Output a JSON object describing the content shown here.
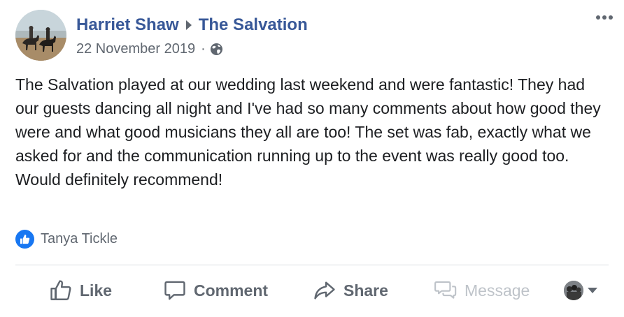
{
  "post": {
    "author": "Harriet Shaw",
    "target_page": "The Salvation",
    "date": "22 November 2019",
    "date_separator": "·",
    "privacy_icon": "globe-icon",
    "body": "The Salvation played at our wedding last weekend and were fantastic! They had our guests dancing all night and I've had so many comments about how good they were and what good musicians they all are too! The set was fab, exactly what we asked for and the communication running up to the event was really good too. Would definitely recommend!",
    "reactions": {
      "icon": "like-icon",
      "names": "Tanya Tickle"
    }
  },
  "actions": {
    "like": "Like",
    "comment": "Comment",
    "share": "Share",
    "message": "Message"
  },
  "colors": {
    "link_blue": "#385898",
    "like_blue": "#1877f2",
    "secondary_text": "#606770",
    "disabled_text": "#bec3c9",
    "divider": "#dadde1"
  }
}
